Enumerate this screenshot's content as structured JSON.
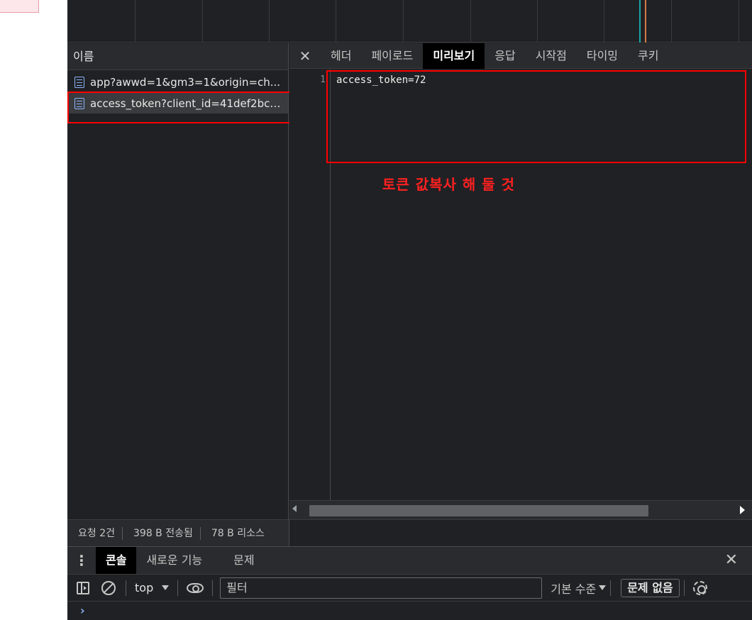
{
  "name_column": {
    "header": "이름",
    "requests": [
      {
        "name": "app?awwd=1&gm3=1&origin=ch..."
      },
      {
        "name": "access_token?client_id=41def2bcf..."
      }
    ]
  },
  "detail": {
    "tabs": [
      "헤더",
      "페이로드",
      "미리보기",
      "응답",
      "시작점",
      "타이밍",
      "쿠키"
    ],
    "active_tab": "미리보기",
    "line_number": "1",
    "preview_text": "access_token=72",
    "annotation": "토큰 값복사 해 둘 것"
  },
  "status_bar": {
    "requests": "요청 2건",
    "transferred": "398 B 전송됨",
    "resources": "78 B 리소스"
  },
  "drawer": {
    "tabs": [
      "콘솔",
      "새로운 기능",
      "문제"
    ],
    "active_tab": "콘솔"
  },
  "console_toolbar": {
    "context": "top",
    "filter_placeholder": "필터",
    "level": "기본 수준",
    "issues": "문제 없음"
  },
  "colors": {
    "annotation": "#ff0000",
    "devtools_bg": "#202124",
    "active_tab_bg": "#000000",
    "link_blue": "#8ab4f8"
  },
  "icons": [
    "close-icon",
    "document-icon",
    "sidebar-toggle-icon",
    "clear-console-icon",
    "chevron-down-icon",
    "eye-icon",
    "gear-icon",
    "more-vert-icon",
    "prompt-chevron-icon"
  ]
}
